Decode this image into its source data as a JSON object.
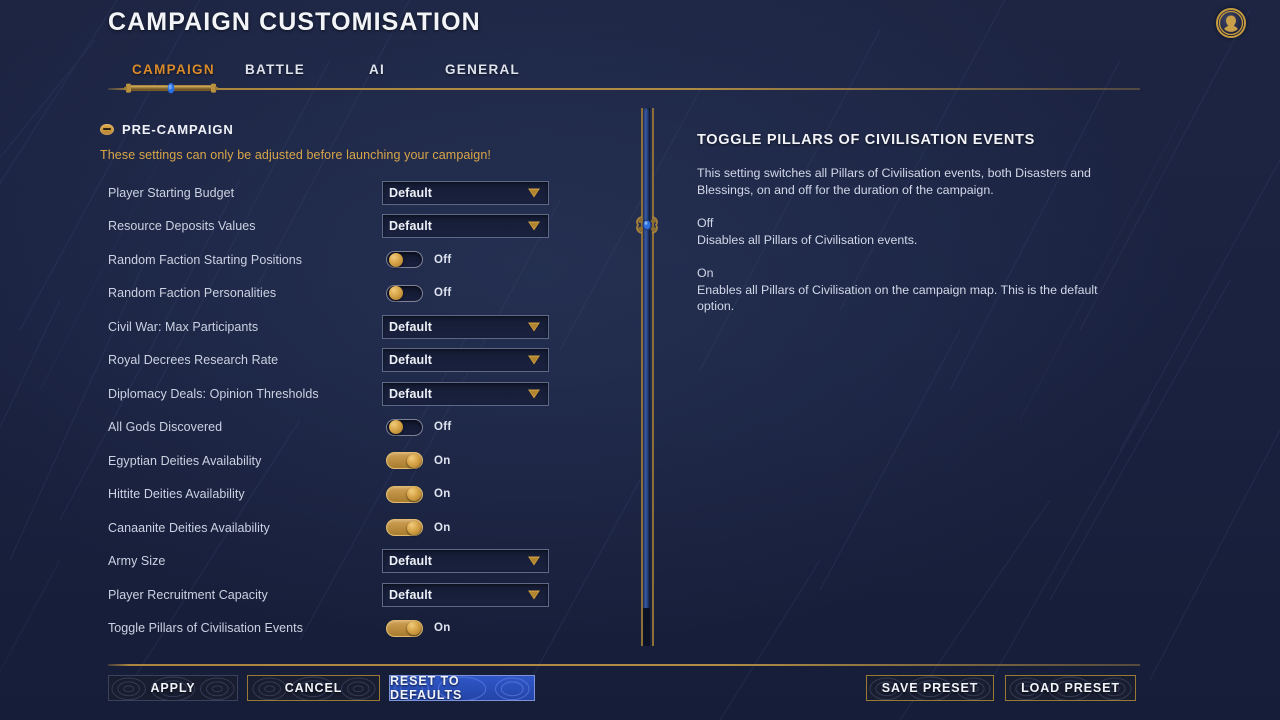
{
  "header": {
    "title": "CAMPAIGN CUSTOMISATION",
    "avatar_icon": "user-bust-medallion-icon"
  },
  "tabs": [
    {
      "id": "campaign",
      "label": "CAMPAIGN",
      "active": true
    },
    {
      "id": "battle",
      "label": "BATTLE",
      "active": false
    },
    {
      "id": "ai",
      "label": "AI",
      "active": false
    },
    {
      "id": "general",
      "label": "GENERAL",
      "active": false
    }
  ],
  "settings_group": {
    "title": "PRE-CAMPAIGN",
    "collapse_icon": "minus-circle-icon",
    "subtitle": "These settings can only be adjusted before launching your campaign!",
    "rows": [
      {
        "label": "Player Starting Budget",
        "control": "dropdown",
        "value": "Default"
      },
      {
        "label": "Resource Deposits Values",
        "control": "dropdown",
        "value": "Default"
      },
      {
        "label": "Random Faction Starting Positions",
        "control": "toggle",
        "value": "Off"
      },
      {
        "label": "Random Faction Personalities",
        "control": "toggle",
        "value": "Off"
      },
      {
        "label": "Civil War: Max Participants",
        "control": "dropdown",
        "value": "Default"
      },
      {
        "label": "Royal Decrees Research Rate",
        "control": "dropdown",
        "value": "Default"
      },
      {
        "label": "Diplomacy Deals: Opinion Thresholds",
        "control": "dropdown",
        "value": "Default"
      },
      {
        "label": "All Gods Discovered",
        "control": "toggle",
        "value": "Off"
      },
      {
        "label": "Egyptian Deities Availability",
        "control": "toggle",
        "value": "On"
      },
      {
        "label": "Hittite Deities Availability",
        "control": "toggle",
        "value": "On"
      },
      {
        "label": "Canaanite Deities Availability",
        "control": "toggle",
        "value": "On"
      },
      {
        "label": "Army Size",
        "control": "dropdown",
        "value": "Default"
      },
      {
        "label": "Player Recruitment Capacity",
        "control": "dropdown",
        "value": "Default"
      },
      {
        "label": "Toggle Pillars of Civilisation Events",
        "control": "toggle",
        "value": "On"
      }
    ]
  },
  "scrollbar": {
    "icon": "scroll-handle-gem-icon"
  },
  "info_panel": {
    "title": "TOGGLE PILLARS OF CIVILISATION EVENTS",
    "description": "This setting switches all Pillars of Civilisation events, both Disasters and Blessings, on and off for the duration of the campaign.",
    "off_term": "Off",
    "off_text": "Disables all Pillars of Civilisation events.",
    "on_term": "On",
    "on_text": "Enables all Pillars of Civilisation on the campaign map. This is the default option."
  },
  "footer": {
    "apply_label": "APPLY",
    "cancel_label": "CANCEL",
    "reset_label": "RESET TO DEFAULTS",
    "save_preset_label": "SAVE PRESET",
    "load_preset_label": "LOAD PRESET"
  },
  "colors": {
    "background": "#1b2340",
    "gold": "#b08c44",
    "accent_orange": "#d98b2b",
    "subtitle_gold": "#d9a648",
    "text_primary": "#f2f4f8",
    "text_secondary": "#ccd2e2",
    "highlight_blue": "#2f57c8",
    "toggle_on_gold": "#cfa054"
  }
}
